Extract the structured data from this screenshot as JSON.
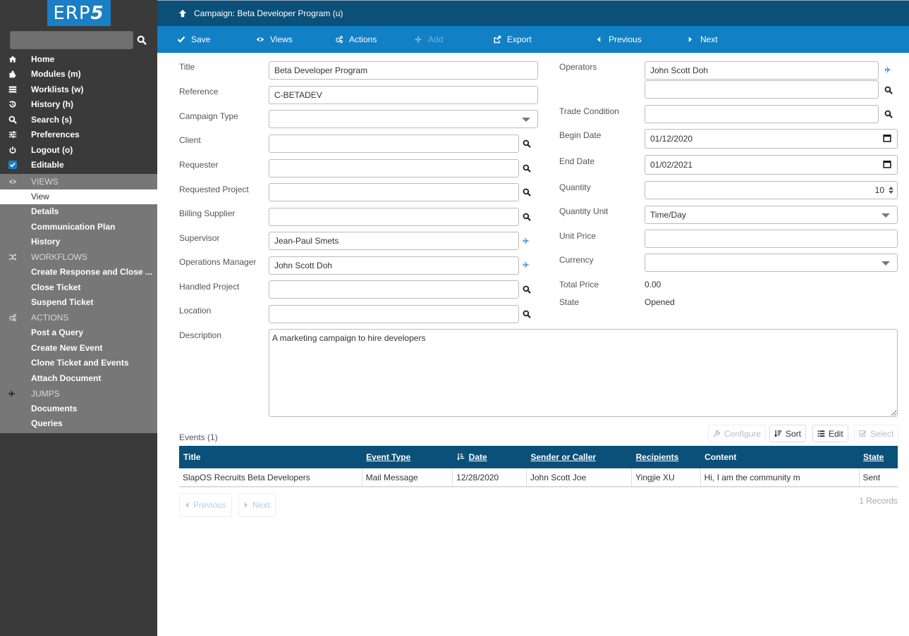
{
  "app": {
    "logo_text": "ERP",
    "logo_suffix": "5"
  },
  "sidebar": {
    "search_placeholder": "",
    "nav": [
      {
        "label": "Home",
        "icon": "home-icon"
      },
      {
        "label": "Modules (m)",
        "icon": "puzzle-icon"
      },
      {
        "label": "Worklists (w)",
        "icon": "tasks-icon"
      },
      {
        "label": "History (h)",
        "icon": "history-icon"
      },
      {
        "label": "Search (s)",
        "icon": "search-icon"
      },
      {
        "label": "Preferences",
        "icon": "sliders-icon"
      },
      {
        "label": "Logout (o)",
        "icon": "power-icon"
      },
      {
        "label": "Editable",
        "icon": "checkbox-checked-icon",
        "checked": true
      }
    ],
    "sections": [
      {
        "header": "VIEWS",
        "icon": "eye-icon",
        "items": [
          "View",
          "Details",
          "Communication Plan",
          "History"
        ],
        "active": "View"
      },
      {
        "header": "WORKFLOWS",
        "icon": "random-icon",
        "items": [
          "Create Response and Close ...",
          "Close Ticket",
          "Suspend Ticket"
        ]
      },
      {
        "header": "ACTIONS",
        "icon": "cogs-icon",
        "items": [
          "Post a Query",
          "Create New Event",
          "Clone Ticket and Events",
          "Attach Document"
        ]
      },
      {
        "header": "JUMPS",
        "icon": "plane-icon",
        "items": [
          "Documents",
          "Queries"
        ]
      }
    ]
  },
  "header": {
    "title": "Campaign: Beta Developer Program (u)"
  },
  "toolbar": {
    "save": "Save",
    "views": "Views",
    "actions": "Actions",
    "add": "Add",
    "export": "Export",
    "previous": "Previous",
    "next": "Next"
  },
  "form": {
    "left": {
      "title": {
        "label": "Title",
        "value": "Beta Developer Program"
      },
      "reference": {
        "label": "Reference",
        "value": "C-BETADEV"
      },
      "campaign_type": {
        "label": "Campaign Type",
        "value": ""
      },
      "client": {
        "label": "Client",
        "value": ""
      },
      "requester": {
        "label": "Requester",
        "value": ""
      },
      "requested_project": {
        "label": "Requested Project",
        "value": ""
      },
      "billing_supplier": {
        "label": "Billing Supplier",
        "value": ""
      },
      "supervisor": {
        "label": "Supervisor",
        "value": "Jean-Paul Smets"
      },
      "operations_manager": {
        "label": "Operations Manager",
        "value": "John Scott Doh"
      },
      "handled_project": {
        "label": "Handled Project",
        "value": ""
      },
      "location": {
        "label": "Location",
        "value": ""
      }
    },
    "right": {
      "operators": {
        "label": "Operators",
        "value": "John Scott Doh",
        "value2": ""
      },
      "trade_condition": {
        "label": "Trade Condition",
        "value": ""
      },
      "begin_date": {
        "label": "Begin Date",
        "value": "01/12/2020"
      },
      "end_date": {
        "label": "End Date",
        "value": "01/02/2021"
      },
      "quantity": {
        "label": "Quantity",
        "value": "10"
      },
      "quantity_unit": {
        "label": "Quantity Unit",
        "value": "Time/Day"
      },
      "unit_price": {
        "label": "Unit Price",
        "value": ""
      },
      "currency": {
        "label": "Currency",
        "value": ""
      },
      "total_price": {
        "label": "Total Price",
        "value": "0.00"
      },
      "state": {
        "label": "State",
        "value": "Opened"
      }
    },
    "description": {
      "label": "Description",
      "value": "A marketing campaign to hire developers"
    }
  },
  "events": {
    "title": "Events (1)",
    "buttons": {
      "configure": "Configure",
      "sort": "Sort",
      "edit": "Edit",
      "select": "Select"
    },
    "columns": [
      "Title",
      "Event Type",
      "Date",
      "Sender or Caller",
      "Recipients",
      "Content",
      "State"
    ],
    "rows": [
      [
        "SlapOS Recruits Beta Developers",
        "Mail Message",
        "12/28/2020",
        "John Scott Joe",
        "Yingjie XU",
        "Hi, I am the community m",
        "Sent"
      ]
    ],
    "pager": {
      "previous": "Previous",
      "next": "Next"
    },
    "records": "1 Records"
  },
  "colors": {
    "header": "#0b5078",
    "toolbar": "#1180c4",
    "sidebar": "#3a3a3a",
    "sidebar_panel": "#777777",
    "jump_icon": "#3a9ae0"
  }
}
